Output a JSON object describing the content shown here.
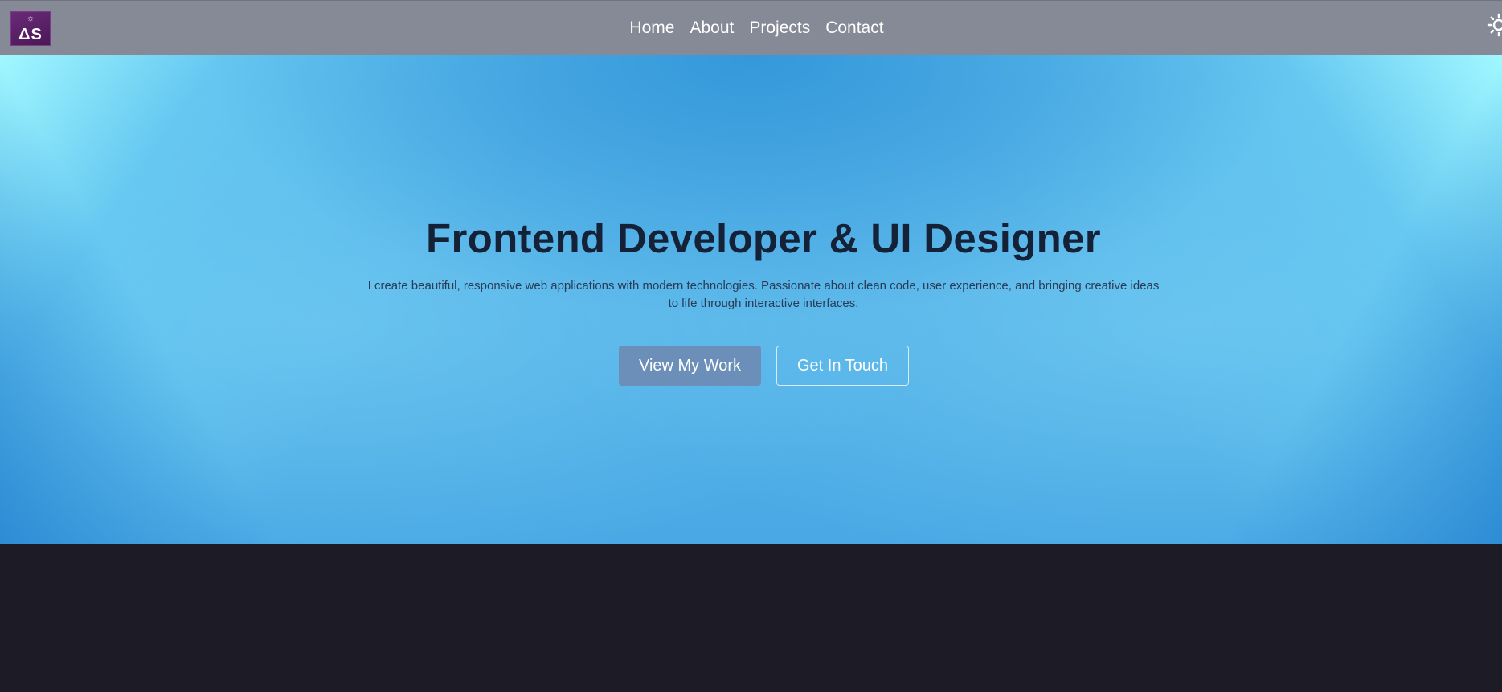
{
  "nav": {
    "logo_text": "ΔS",
    "logo_mark": "☼",
    "links": [
      "Home",
      "About",
      "Projects",
      "Contact"
    ],
    "theme_icon": "sun-icon"
  },
  "hero": {
    "title": "Frontend Developer & UI Designer",
    "subtitle": "I create beautiful, responsive web applications with modern technologies. Passionate about clean code, user experience, and bringing creative ideas to life through interactive interfaces.",
    "primary_button": "View My Work",
    "secondary_button": "Get In Touch"
  },
  "colors": {
    "navbar": "#868a96",
    "hero_blue": "#4aa8e4",
    "hero_glow": "#a0f8ff",
    "title": "#142136",
    "primary_button": "#6b8fb8",
    "logo": "#5a2066",
    "dark_section": "#1c1b26"
  }
}
